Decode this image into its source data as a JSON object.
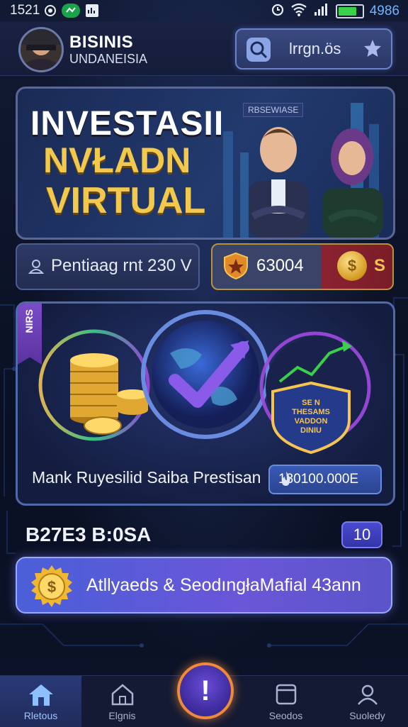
{
  "status_bar": {
    "time": "1521",
    "battery_text": "4986"
  },
  "header": {
    "title": "BISINIS",
    "subtitle": "UNDANEISIA",
    "search_text": "lrrgn.ös"
  },
  "banner": {
    "line1": "INVESTASII",
    "line2": "NVŁADN",
    "line3": "VIRTUAL",
    "tag": "RBSEWIASE"
  },
  "stats": {
    "left_text": "Pentiaag rnt 230 V",
    "right_value": "63004",
    "right_currency": "S",
    "coin_symbol": "$"
  },
  "feature_card": {
    "ribbon": "NIRS",
    "shield_text": "SE N\nTHESAMS\nVADDON\nDINIU",
    "label": "Mank Ruyesilid Saiba Prestisan",
    "value": "130100.000E"
  },
  "section": {
    "title": "B27E3 B:0SA",
    "badge": "10"
  },
  "cta": {
    "label": "Atllyaeds & SeodıngłaMafial 43ann",
    "coin_symbol": "$"
  },
  "center_button": {
    "label": "!"
  },
  "nav": {
    "items": [
      {
        "label": "Rletous",
        "icon": "home-icon"
      },
      {
        "label": "Elgnis",
        "icon": "house-outline-icon"
      },
      {
        "label": "Seodos",
        "icon": "window-icon"
      },
      {
        "label": "Suoledy",
        "icon": "user-icon"
      }
    ]
  },
  "colors": {
    "accent_gold": "#f2c94c",
    "accent_blue": "#5a6fe0",
    "nav_active": "#2a3a78",
    "center_ring": "#f08a3a"
  }
}
